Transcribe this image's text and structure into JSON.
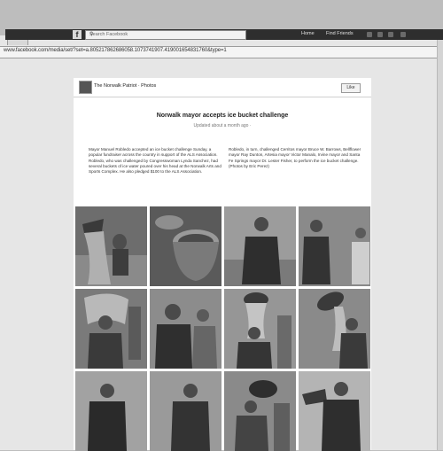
{
  "browser": {
    "url": "www.facebook.com/media/set/?set=a.805217862686058.1073741907.419001654831760&type=1"
  },
  "facebook": {
    "logo": "f",
    "search_placeholder": "Search Facebook",
    "nav": {
      "home": "Home",
      "profile": "Find Friends"
    }
  },
  "page": {
    "name": "The Norwalk Patriot · Photos",
    "like_label": "Like"
  },
  "album": {
    "title": "Norwalk mayor accepts ice bucket challenge",
    "subtitle": "Updated about a month ago ·",
    "desc_left": "Mayor Manuel Robledo accepted an ice bucket challenge Sunday, a popular fundraiser across the country in support of the ALS Association. Robledo, who was challenged by Congresswoman Lynda Sanchez, had several buckets of ice water poured over his head at the Norwalk Arts and Sports Complex. He also pledged $100 to the ALS Association.",
    "desc_right": "Robledo, in turn, challenged Cerritos mayor Bruce W. Barrows, Bellflower mayor Ray Dunton, Artesia mayor Victor Manalo, Irvine mayor and Santa Fe Springs mayor Dr. Lester Fisher, to perform the ice bucket challenge. (Photos by Eric Perez)"
  },
  "photos": [
    {
      "scene": "bucket-over-head"
    },
    {
      "scene": "bucket-closeup"
    },
    {
      "scene": "man-standing"
    },
    {
      "scene": "man-standing-side"
    },
    {
      "scene": "water-splash"
    },
    {
      "scene": "man-wet"
    },
    {
      "scene": "two-buckets"
    },
    {
      "scene": "bucket-tipping"
    },
    {
      "scene": "man-seated"
    },
    {
      "scene": "man-seated-2"
    },
    {
      "scene": "bucket-raised"
    },
    {
      "scene": "pour-from-side"
    }
  ],
  "colors": {
    "fb_bar": "#2e2e2e",
    "page_bg": "#ffffff",
    "chrome_bg": "#bdbdbd"
  }
}
